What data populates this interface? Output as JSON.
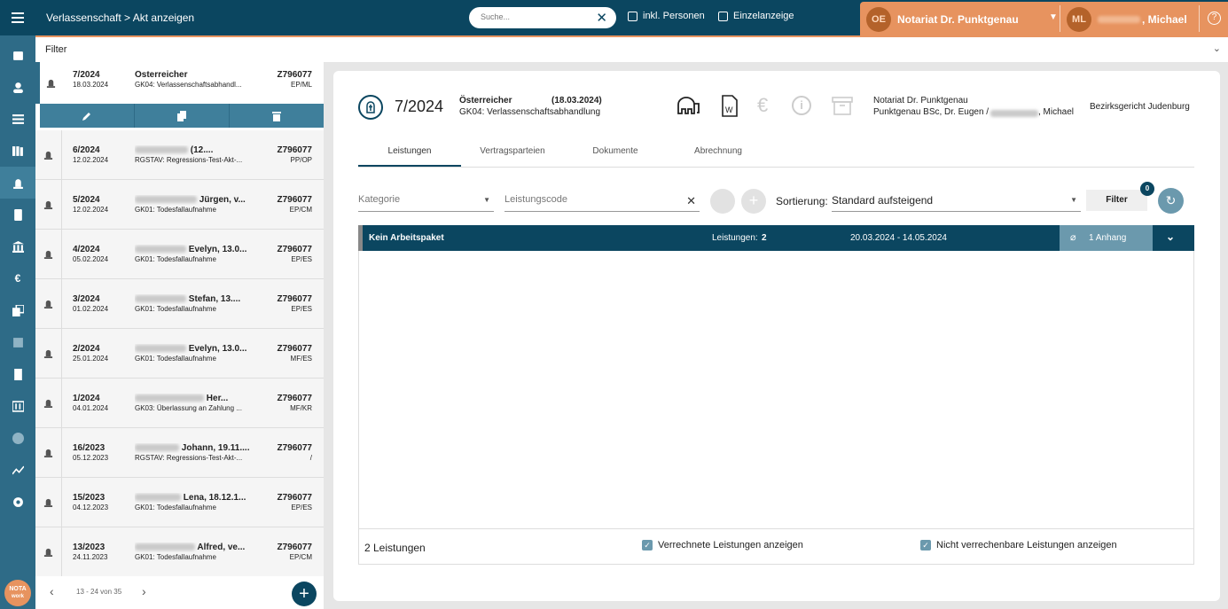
{
  "header": {
    "breadcrumb": "Verlassenschaft > Akt anzeigen",
    "search_placeholder": "Suche...",
    "inkl_personen": "inkl. Personen",
    "einzelanzeige": "Einzelanzeige",
    "org_initials": "OE",
    "org_name": "Notariat Dr. Punktgenau",
    "user_initials": "ML",
    "user_name": ", Michael"
  },
  "filter_label": "Filter",
  "list": {
    "selected": {
      "nr": "7/2024",
      "date": "18.03.2024",
      "name": "Österreicher",
      "desc": "GK04: Verlassenschaftsabhandl...",
      "code": "Z796077",
      "sub": "EP/ML"
    },
    "rows": [
      {
        "nr": "6/2024",
        "date": "12.02.2024",
        "name": "(12....",
        "desc": "RGSTAV: Regressions-Test-Akt-...",
        "code": "Z796077",
        "sub": "PP/OP"
      },
      {
        "nr": "5/2024",
        "date": "12.02.2024",
        "name": "Jürgen, v...",
        "desc": "GK01: Todesfallaufnahme",
        "code": "Z796077",
        "sub": "EP/CM"
      },
      {
        "nr": "4/2024",
        "date": "05.02.2024",
        "name": "Evelyn, 13.0...",
        "desc": "GK01: Todesfallaufnahme",
        "code": "Z796077",
        "sub": "EP/ES"
      },
      {
        "nr": "3/2024",
        "date": "01.02.2024",
        "name": "Stefan, 13....",
        "desc": "GK01: Todesfallaufnahme",
        "code": "Z796077",
        "sub": "EP/ES"
      },
      {
        "nr": "2/2024",
        "date": "25.01.2024",
        "name": "Evelyn, 13.0...",
        "desc": "GK01: Todesfallaufnahme",
        "code": "Z796077",
        "sub": "MF/ES"
      },
      {
        "nr": "1/2024",
        "date": "04.01.2024",
        "name": "Her...",
        "desc": "GK03: Überlassung an Zahlung ...",
        "code": "Z796077",
        "sub": "MF/KR"
      },
      {
        "nr": "16/2023",
        "date": "05.12.2023",
        "name": "Johann, 19.11....",
        "desc": "RGSTAV: Regressions-Test-Akt-...",
        "code": "Z796077",
        "sub": "/"
      },
      {
        "nr": "15/2023",
        "date": "04.12.2023",
        "name": "Lena, 18.12.1...",
        "desc": "GK01: Todesfallaufnahme",
        "code": "Z796077",
        "sub": "EP/ES"
      },
      {
        "nr": "13/2023",
        "date": "24.11.2023",
        "name": "Alfred, ve...",
        "desc": "GK01: Todesfallaufnahme",
        "code": "Z796077",
        "sub": "EP/CM"
      }
    ],
    "pager": "13 - 24 von 35"
  },
  "detail": {
    "nr": "7/2024",
    "name": "Österreicher",
    "date": "(18.03.2024)",
    "desc": "GK04: Verlassenschaftsabhandlung",
    "notary": "Notariat Dr. Punktgenau",
    "persons": "Punktgenau BSc, Dr. Eugen /",
    "persons_end": ", Michael",
    "court": "Bezirksgericht Judenburg",
    "tabs": [
      "Leistungen",
      "Vertragsparteien",
      "Dokumente",
      "Abrechnung"
    ],
    "kategorie": "Kategorie",
    "leistungscode": "Leistungscode",
    "sortierung_label": "Sortierung:",
    "sortierung": "Standard aufsteigend",
    "filter_btn": "Filter",
    "filter_count": "0",
    "group": {
      "title": "Kein Arbeitspaket",
      "count_label": "Leistungen:",
      "count": "2",
      "range": "20.03.2024 - 14.05.2024",
      "attach": "1 Anhang"
    },
    "total": "2 Leistungen",
    "chk1": "Verrechnete Leistungen anzeigen",
    "chk2": "Nicht verrechenbare Leistungen anzeigen"
  }
}
